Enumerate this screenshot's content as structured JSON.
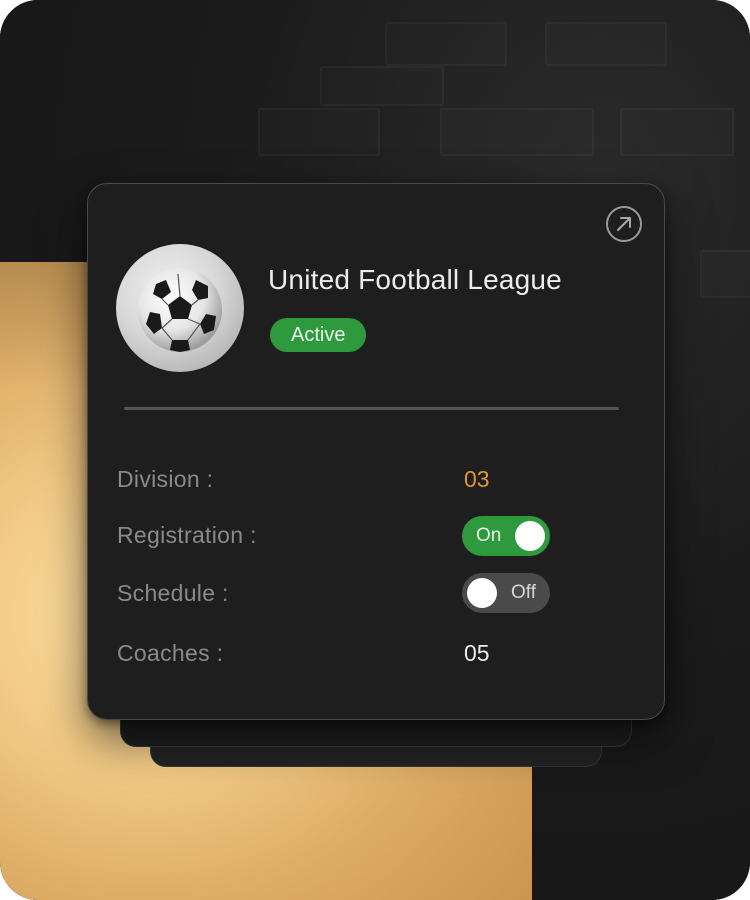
{
  "league": {
    "name": "United Football League",
    "status": "Active",
    "logo_icon": "soccer-ball-icon",
    "open_icon": "arrow-up-right-circle-icon"
  },
  "details": [
    {
      "label": "Division :",
      "value": "03"
    },
    {
      "label": "Registration :",
      "state_text": "On",
      "enabled": true
    },
    {
      "label": "Schedule :",
      "state_text": "Off",
      "enabled": false
    },
    {
      "label": "Coaches :",
      "value": "05"
    }
  ],
  "colors": {
    "accent_green": "#2f9a3d",
    "accent_orange": "#e0972f",
    "card_bg": "#1e1e1e",
    "gold": "#f3cb86"
  }
}
